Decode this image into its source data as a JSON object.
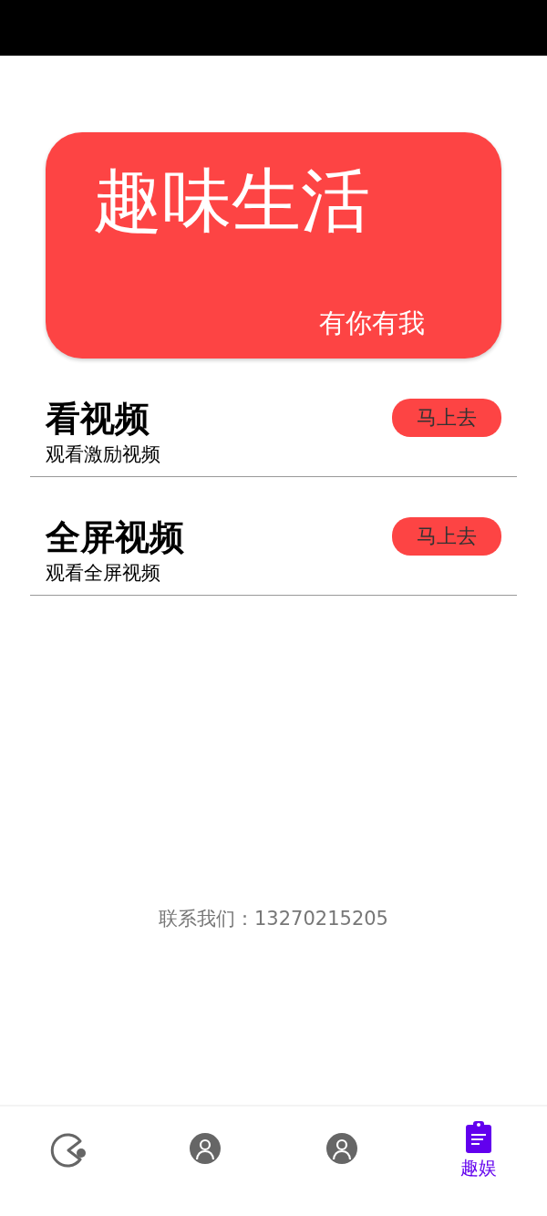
{
  "banner": {
    "title": "趣味生活",
    "subtitle": "有你有我"
  },
  "tasks": [
    {
      "title": "看视频",
      "subtitle": "观看激励视频",
      "button": "马上去"
    },
    {
      "title": "全屏视频",
      "subtitle": "观看全屏视频",
      "button": "马上去"
    }
  ],
  "contact": "联系我们：13270215205",
  "nav": [
    {
      "kind": "game",
      "selected": false
    },
    {
      "kind": "person",
      "selected": false
    },
    {
      "kind": "person",
      "selected": false
    },
    {
      "kind": "clipboard",
      "label": "趣娱",
      "selected": true
    }
  ]
}
